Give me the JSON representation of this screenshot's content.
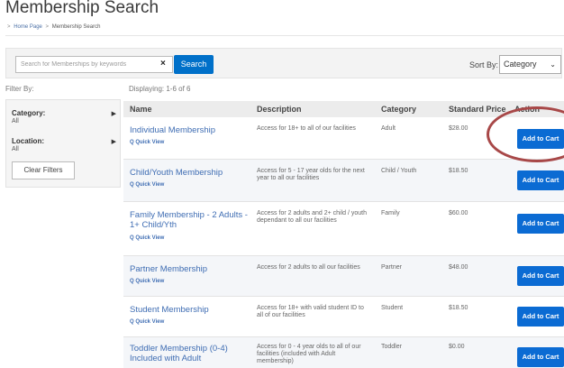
{
  "page": {
    "title": "Membership Search"
  },
  "breadcrumb": {
    "lead": ">",
    "home": "Home Page",
    "separator": ">",
    "current": "Membership Search"
  },
  "search": {
    "placeholder": "Search for Memberships by keywords",
    "clear_icon": "×",
    "button_label": "Search",
    "sort_label": "Sort By:",
    "sort_value": "Category",
    "sort_chevron": "⌄"
  },
  "filters": {
    "heading": "Filter By:",
    "category_label": "Category:",
    "category_value": "All",
    "location_label": "Location:",
    "location_value": "All",
    "arrow": "▶",
    "clear_button": "Clear Filters"
  },
  "results": {
    "displaying": "Displaying: 1-6 of 6",
    "columns": {
      "name": "Name",
      "description": "Description",
      "category": "Category",
      "price": "Standard Price",
      "action": "Action"
    },
    "quick_view_label": "Q Quick View",
    "cart_label": "Add to Cart",
    "rows": [
      {
        "name": "Individual Membership",
        "description": "Access for 18+ to all of our facilities",
        "category": "Adult",
        "price": "$28.00"
      },
      {
        "name": "Child/Youth Membership",
        "description": "Access for 5 - 17 year olds for the next year to all our facilities",
        "category": "Child / Youth",
        "price": "$18.50"
      },
      {
        "name": "Family Membership - 2 Adults - 1+ Child/Yth",
        "description": "Access for 2 adults and 2+ child / youth dependant to all our facilities",
        "category": "Family",
        "price": "$60.00"
      },
      {
        "name": "Partner Membership",
        "description": "Access for 2 adults to all our facilities",
        "category": "Partner",
        "price": "$48.00"
      },
      {
        "name": "Student Membership",
        "description": "Access for 18+ with valid student ID to all of our facilities",
        "category": "Student",
        "price": "$18.50"
      },
      {
        "name": "Toddler Membership (0-4) Included with Adult",
        "description": "Access for 0 - 4 year olds to all of our facilities (included with Adult membership)",
        "category": "Toddler",
        "price": "$0.00"
      }
    ]
  },
  "colors": {
    "accent": "#0b6bd3",
    "link": "#3f6db3",
    "annotation": "#a84848"
  }
}
